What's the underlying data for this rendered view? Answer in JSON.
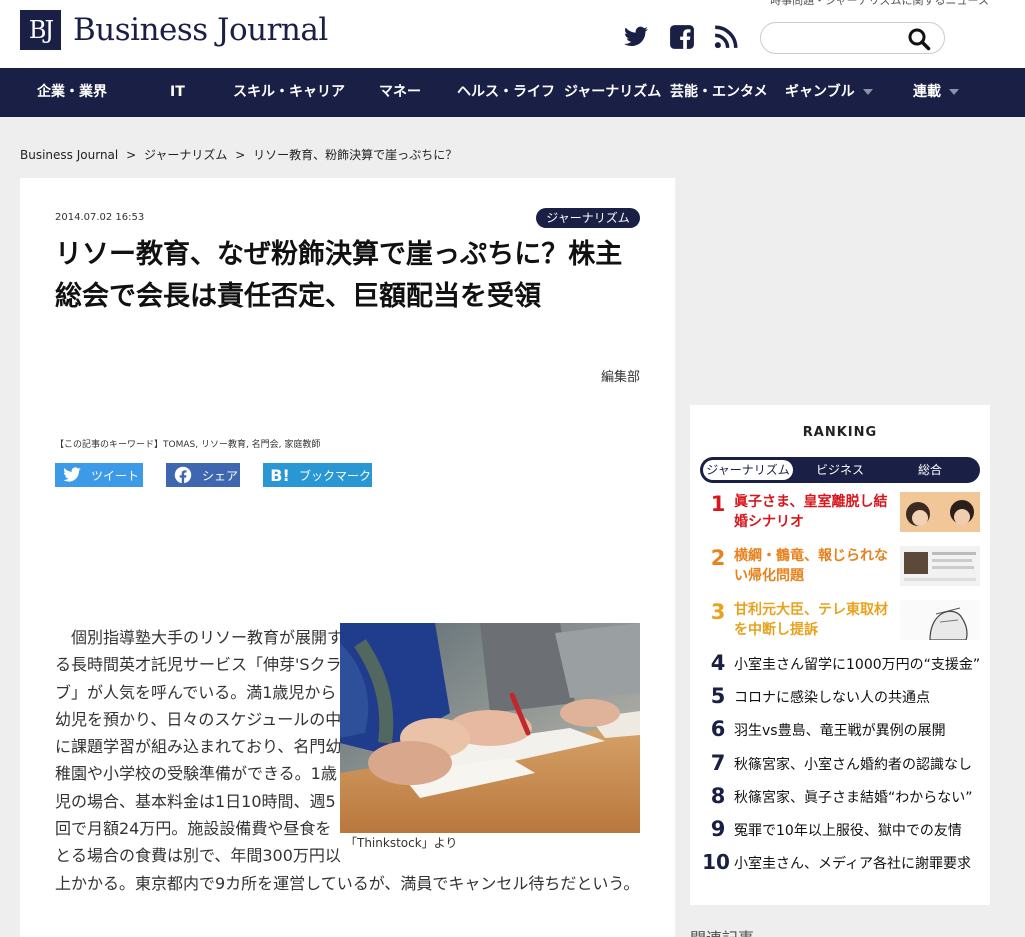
{
  "header": {
    "logo_mark": "BJ",
    "logo_text": "Business Journal",
    "tagline": "時事問題・ジャーナリズムに関するニュース",
    "search_placeholder": "",
    "social": [
      "twitter-icon",
      "facebook-icon",
      "rss-icon"
    ]
  },
  "nav": {
    "items": [
      {
        "label": "企業・業界"
      },
      {
        "label": "IT"
      },
      {
        "label": "スキル・キャリア"
      },
      {
        "label": "マネー"
      },
      {
        "label": "ヘルス・ライフ"
      },
      {
        "label": "ジャーナリズム"
      },
      {
        "label": "芸能・エンタメ"
      },
      {
        "label": "ギャンブル"
      },
      {
        "label": "連載"
      }
    ]
  },
  "breadcrumb": {
    "home": "Business Journal",
    "sep1": ">",
    "category": "ジャーナリズム",
    "sep2": ">",
    "current": "リソー教育、粉飾決算で崖っぷちに？"
  },
  "article": {
    "date": "2014.07.02 16:53",
    "category": "ジャーナリズム",
    "title": "リソー教育、なぜ粉飾決算で崖っぷちに？株主総会で会長は責任否定、巨額配当を受領",
    "author": "編集部",
    "keywords": "【この記事のキーワード】TOMAS, リソー教育, 名門会, 家庭教師",
    "share": {
      "tweet": "ツイート",
      "share": "シェア",
      "bookmark": "ブックマーク"
    },
    "photo_caption": "「Thinkstock」より",
    "body": "　個別指導塾大手のリソー教育が展開する長時間英才託児サービス「伸芽'Sクラブ」が人気を呼んでいる。満1歳児から幼児を預かり、日々のスケジュールの中に課題学習が組み込まれており、名門幼稚園や小学校の受験準備ができる。1歳児の場合、基本料金は1日10時間、週5回で月額24万円。施設設備費や昼食をとる場合の食費は別で、年間300万円以上かかる。東京都内で9カ所を運営しているが、満員でキャンセル待ちだという。"
  },
  "ranking": {
    "title": "RANKING",
    "tabs": [
      "ジャーナリズム",
      "ビジネス",
      "総合"
    ],
    "items": [
      {
        "rank": "1",
        "text": "眞子さま、皇室離脱し結婚シナリオ",
        "color": "#d7171d"
      },
      {
        "rank": "2",
        "text": "横綱・鶴竜、報じられない帰化問題",
        "color": "#e8821e"
      },
      {
        "rank": "3",
        "text": "甘利元大臣、テレ東取材を中断し提訴",
        "color": "#e8a21e"
      },
      {
        "rank": "4",
        "text": "小室圭さん留学に1000万円の“支援金”"
      },
      {
        "rank": "5",
        "text": "コロナに感染しない人の共通点"
      },
      {
        "rank": "6",
        "text": "羽生vs豊島、竜王戦が異例の展開"
      },
      {
        "rank": "7",
        "text": "秋篠宮家、小室さん婚約者の認識なし"
      },
      {
        "rank": "8",
        "text": "秋篠宮家、眞子さま結婚“わからない”"
      },
      {
        "rank": "9",
        "text": "冤罪で10年以上服役、獄中での友情"
      },
      {
        "rank": "10",
        "text": "小室圭さん、メディア各社に謝罪要求"
      }
    ]
  },
  "sidebar_next_heading": "関連記事"
}
